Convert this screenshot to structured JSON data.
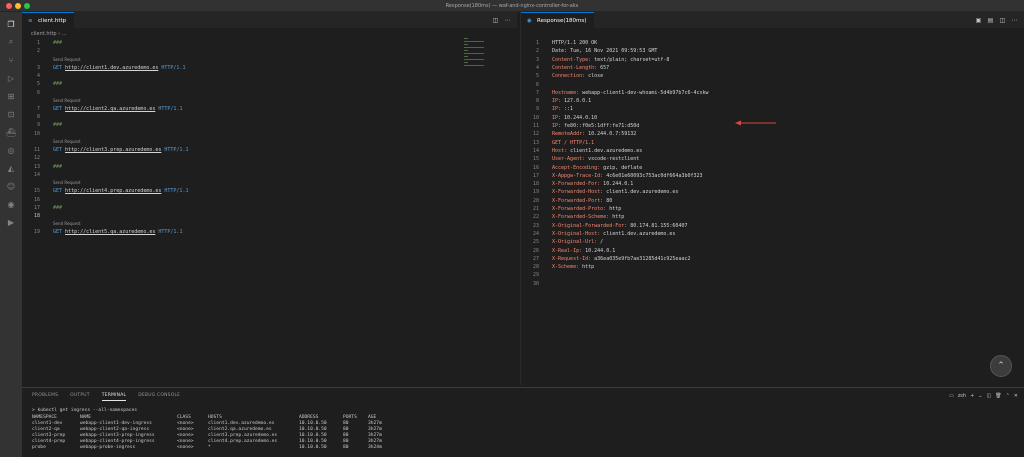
{
  "window": {
    "title": "Response(180ms) — waf-and-nginx-controller-for-aks"
  },
  "activity_icons": [
    "files-icon",
    "search-icon",
    "source-control-icon",
    "run-debug-icon",
    "extensions-icon",
    "remote-explorer-icon",
    "docker-icon",
    "github-icon",
    "azure-icon",
    "accounts-icon",
    "github-actions-icon",
    "settings-icon"
  ],
  "left_editor": {
    "tab_label": "client.http",
    "breadcrumb": "client.http › ...",
    "codelens": "Send Request",
    "lines": [
      {
        "n": "1",
        "kind": "sep",
        "text": "###"
      },
      {
        "n": "2",
        "kind": "blank",
        "text": ""
      },
      {
        "n": "3",
        "kind": "req",
        "method": "GET",
        "url": "http://client1.dev.azuredemo.es",
        "ver": "HTTP/1.1",
        "lens": true
      },
      {
        "n": "4",
        "kind": "blank",
        "text": ""
      },
      {
        "n": "5",
        "kind": "sep",
        "text": "###"
      },
      {
        "n": "6",
        "kind": "blank",
        "text": ""
      },
      {
        "n": "7",
        "kind": "req",
        "method": "GET",
        "url": "http://client2.qa.azuredemo.es",
        "ver": "HTTP/1.1",
        "lens": true
      },
      {
        "n": "8",
        "kind": "blank",
        "text": ""
      },
      {
        "n": "9",
        "kind": "sep",
        "text": "###"
      },
      {
        "n": "10",
        "kind": "blank",
        "text": ""
      },
      {
        "n": "11",
        "kind": "req",
        "method": "GET",
        "url": "http://client3.prep.azuredemo.es",
        "ver": "HTTP/1.1",
        "lens": true
      },
      {
        "n": "12",
        "kind": "blank",
        "text": ""
      },
      {
        "n": "13",
        "kind": "sep",
        "text": "###"
      },
      {
        "n": "14",
        "kind": "blank",
        "text": ""
      },
      {
        "n": "15",
        "kind": "req",
        "method": "GET",
        "url": "http://client4.prep.azuredemo.es",
        "ver": "HTTP/1.1",
        "lens": true
      },
      {
        "n": "16",
        "kind": "blank",
        "text": ""
      },
      {
        "n": "17",
        "kind": "sep",
        "text": "###"
      },
      {
        "n": "18",
        "kind": "blank",
        "text": ""
      },
      {
        "n": "19",
        "kind": "req",
        "method": "GET",
        "url": "http://client5.qa.azuredemo.es",
        "ver": "HTTP/1.1",
        "lens": true
      }
    ]
  },
  "right_editor": {
    "tab_label": "Response(180ms)",
    "lines": [
      {
        "n": "1",
        "k": "HTTP/1.1 200 OK",
        "v": "",
        "style": "white"
      },
      {
        "n": "2",
        "k": "Date:",
        "v": " Tue, 16 Nov 2021 09:59:53 GMT",
        "style": "white"
      },
      {
        "n": "3",
        "k": "Content-Type:",
        "v": " text/plain; charset=utf-8",
        "style": "hdr"
      },
      {
        "n": "4",
        "k": "Content-Length:",
        "v": " 657",
        "style": "hdr"
      },
      {
        "n": "5",
        "k": "Connection:",
        "v": " close",
        "style": "hdr"
      },
      {
        "n": "6",
        "k": "",
        "v": "",
        "style": "white"
      },
      {
        "n": "7",
        "k": "Hostname:",
        "v": " webapp-client1-dev-whoami-5d4b97b7c6-4cxkw",
        "style": "hdr"
      },
      {
        "n": "8",
        "k": "IP:",
        "v": " 127.0.0.1",
        "style": "hdr"
      },
      {
        "n": "9",
        "k": "IP:",
        "v": " ::1",
        "style": "hdr"
      },
      {
        "n": "10",
        "k": "IP:",
        "v": " 10.244.0.10",
        "style": "hdr"
      },
      {
        "n": "11",
        "k": "IP:",
        "v": " fe80::f0e5:1dff:fe71:d50d",
        "style": "hdr"
      },
      {
        "n": "12",
        "k": "RemoteAddr:",
        "v": " 10.244.0.7:59132",
        "style": "hdr"
      },
      {
        "n": "13",
        "k": "GET / HTTP/1.1",
        "v": "",
        "style": "hdr"
      },
      {
        "n": "14",
        "k": "Host:",
        "v": " client1.dev.azuredemo.es",
        "style": "hdr"
      },
      {
        "n": "15",
        "k": "User-Agent:",
        "v": " vscode-restclient",
        "style": "hdr"
      },
      {
        "n": "16",
        "k": "Accept-Encoding:",
        "v": " gzip, deflate",
        "style": "hdr"
      },
      {
        "n": "17",
        "k": "X-Appgw-Trace-Id:",
        "v": " 4c6e01e60093c753ac0df664a3b0f323",
        "style": "hdr"
      },
      {
        "n": "18",
        "k": "X-Forwarded-For:",
        "v": " 10.244.0.1",
        "style": "hdr"
      },
      {
        "n": "19",
        "k": "X-Forwarded-Host:",
        "v": " client1.dev.azuredemo.es",
        "style": "hdr"
      },
      {
        "n": "20",
        "k": "X-Forwarded-Port:",
        "v": " 80",
        "style": "hdr"
      },
      {
        "n": "21",
        "k": "X-Forwarded-Proto:",
        "v": " http",
        "style": "hdr"
      },
      {
        "n": "22",
        "k": "X-Forwarded-Scheme:",
        "v": " http",
        "style": "hdr"
      },
      {
        "n": "23",
        "k": "X-Original-Forwarded-For:",
        "v": " 80.174.81.155:60407",
        "style": "hdr"
      },
      {
        "n": "24",
        "k": "X-Original-Host:",
        "v": " client1.dev.azuredemo.es",
        "style": "hdr"
      },
      {
        "n": "25",
        "k": "X-Original-Url:",
        "v": " /",
        "style": "hdr"
      },
      {
        "n": "26",
        "k": "X-Real-Ip:",
        "v": " 10.244.0.1",
        "style": "hdr"
      },
      {
        "n": "27",
        "k": "X-Request-Id:",
        "v": " a36ea035e9fb7ae31285d41c925eaac2",
        "style": "hdr"
      },
      {
        "n": "28",
        "k": "X-Scheme:",
        "v": " http",
        "style": "hdr"
      },
      {
        "n": "29",
        "k": "",
        "v": "",
        "style": "white"
      },
      {
        "n": "30",
        "k": "",
        "v": "",
        "style": "white"
      }
    ]
  },
  "panel": {
    "tabs": [
      "PROBLEMS",
      "OUTPUT",
      "TERMINAL",
      "DEBUG CONSOLE"
    ],
    "active_tab": "TERMINAL",
    "shell_label": "zsh",
    "command": "> kubectl get ingress --all-namespaces",
    "columns": [
      "NAMESPACE",
      "NAME",
      "CLASS",
      "HOSTS",
      "ADDRESS",
      "PORTS",
      "AGE"
    ],
    "rows": [
      [
        "client1-dev",
        "webapp-client1-dev-ingress",
        "<none>",
        "client1.dev.azuredemo.es",
        "10.10.0.50",
        "80",
        "3h27m"
      ],
      [
        "client2-qa",
        "webapp-client2-qa-ingress",
        "<none>",
        "client2.qa.azuredemo.es",
        "10.10.0.50",
        "80",
        "3h27m"
      ],
      [
        "client3-prep",
        "webapp-client3-prep-ingress",
        "<none>",
        "client3.prep.azuredemo.es",
        "10.10.0.50",
        "80",
        "3h27m"
      ],
      [
        "client4-prep",
        "webapp-client4-prep-ingress",
        "<none>",
        "client4.prep.azuredemo.es",
        "10.10.0.50",
        "80",
        "3h27m"
      ],
      [
        "probe",
        "webapp-probe-ingress",
        "<none>",
        "*",
        "10.10.0.50",
        "80",
        "3h24m"
      ]
    ]
  },
  "colors": {
    "accent": "#0078d4",
    "arrow": "#e0443e"
  }
}
